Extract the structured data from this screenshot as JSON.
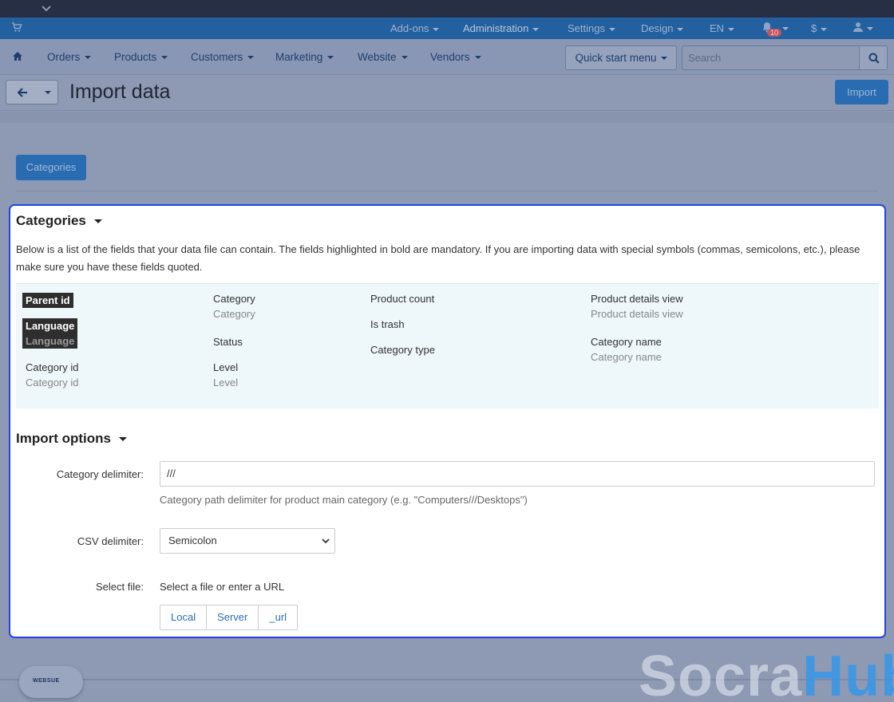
{
  "admin_bar": {
    "items": [
      {
        "label": "Add-ons"
      },
      {
        "label": "Administration"
      },
      {
        "label": "Settings"
      },
      {
        "label": "Design"
      },
      {
        "label": "EN"
      },
      {
        "label": "$"
      }
    ],
    "notification_count": "10",
    "icons": {
      "cart": "cart-icon",
      "bell": "bell-icon",
      "user": "user-icon",
      "collapse": "chevron-down-icon"
    }
  },
  "main_nav": {
    "items": [
      {
        "label": "Orders"
      },
      {
        "label": "Products"
      },
      {
        "label": "Customers"
      },
      {
        "label": "Marketing"
      },
      {
        "label": "Website"
      },
      {
        "label": "Vendors"
      }
    ],
    "quick_start_label": "Quick start menu",
    "search_placeholder": "Search"
  },
  "page_header": {
    "title": "Import data",
    "import_label": "Import"
  },
  "tabs": [
    {
      "label": "Categories"
    }
  ],
  "categories_section": {
    "title": "Categories",
    "description": "Below is a list of the fields that your data file can contain. The fields highlighted in bold are mandatory. If you are importing data with special symbols (commas, semicolons, etc.), please make sure you have these fields quoted.",
    "fields": {
      "parent_id": {
        "name": "Parent id"
      },
      "language": {
        "name": "Language",
        "example": "Language"
      },
      "category_id": {
        "name": "Category id",
        "example": "Category id"
      },
      "category": {
        "name": "Category",
        "example": "Category"
      },
      "status": {
        "name": "Status"
      },
      "level": {
        "name": "Level",
        "example": "Level"
      },
      "product_count": {
        "name": "Product count"
      },
      "is_trash": {
        "name": "Is trash"
      },
      "category_type": {
        "name": "Category type"
      },
      "product_details_view": {
        "name": "Product details view",
        "example": "Product details view"
      },
      "category_name": {
        "name": "Category name",
        "example": "Category name"
      }
    }
  },
  "import_options": {
    "title": "Import options",
    "category_delimiter": {
      "label": "Category delimiter:",
      "value": "///",
      "hint": "Category path delimiter for product main category (e.g. \"Computers///Desktops\")"
    },
    "csv_delimiter": {
      "label": "CSV delimiter:",
      "selected": "Semicolon"
    },
    "select_file": {
      "label": "Select file:",
      "text": "Select a file or enter a URL",
      "buttons": [
        "Local",
        "Server",
        "_url"
      ]
    }
  },
  "footer": {
    "brand_logo_text": "WEBSUE",
    "watermark_part1": "Socra",
    "watermark_part2": "Hub"
  }
}
